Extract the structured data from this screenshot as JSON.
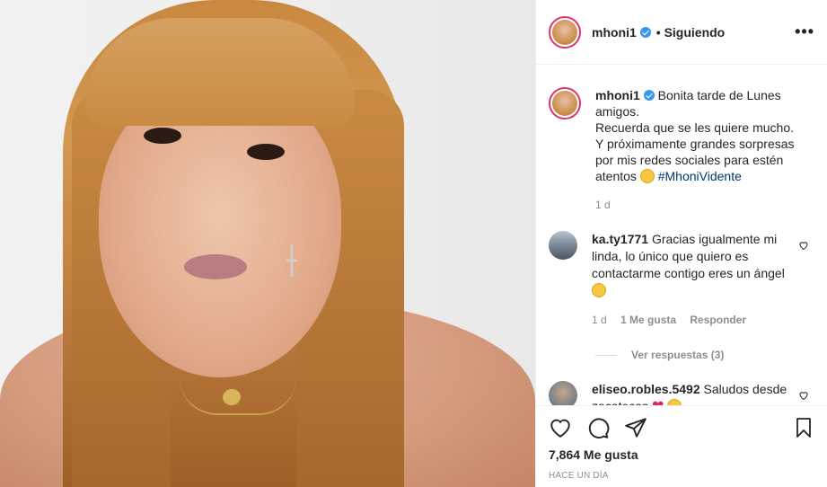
{
  "post": {
    "username": "mhoni1",
    "follow_status": "• Siguiendo",
    "more_icon": "more-options-icon",
    "caption_text": "Bonita tarde de Lunes amigos.\nRecuerda que se les quiere mucho. Y próximamente grandes sorpresas por mis redes sociales para estén atentos",
    "caption_line1": "Bonita tarde de Lunes amigos.",
    "caption_line2": "Recuerda que se les quiere mucho. Y próximamente grandes sorpresas por mis redes sociales para estén atentos",
    "hashtag": "#MhoniVidente",
    "caption_time": "1 d",
    "likes": "7,864 Me gusta",
    "posted_ago": "HACE UN DÍA"
  },
  "comments": [
    {
      "username": "ka.ty1771",
      "text": "Gracias igualmente mi linda, lo único que quiero es contactarme contigo eres un ángel",
      "time": "1 d",
      "likes": "1 Me gusta",
      "reply_label": "Responder",
      "view_replies": "Ver respuestas (3)"
    },
    {
      "username": "eliseo.robles.5492",
      "text": "Saludos desde zacatecas"
    }
  ],
  "colors": {
    "verified": "#3897f0",
    "hashtag": "#00376b",
    "meta": "#8e8e8e",
    "story_ring": "#e1306c"
  }
}
